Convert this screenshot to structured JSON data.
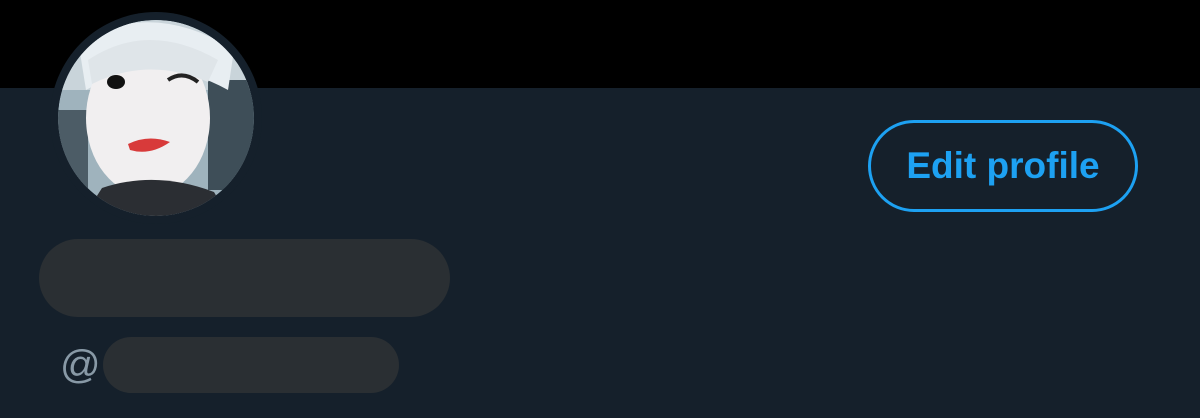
{
  "profile": {
    "edit_button_label": "Edit profile",
    "handle_prefix": "@",
    "avatar_icon": "profile-photo"
  },
  "colors": {
    "banner": "#000000",
    "background": "#15202b",
    "accent": "#1da1f2",
    "placeholder": "#2a2f33",
    "muted_text": "#8899a6"
  }
}
